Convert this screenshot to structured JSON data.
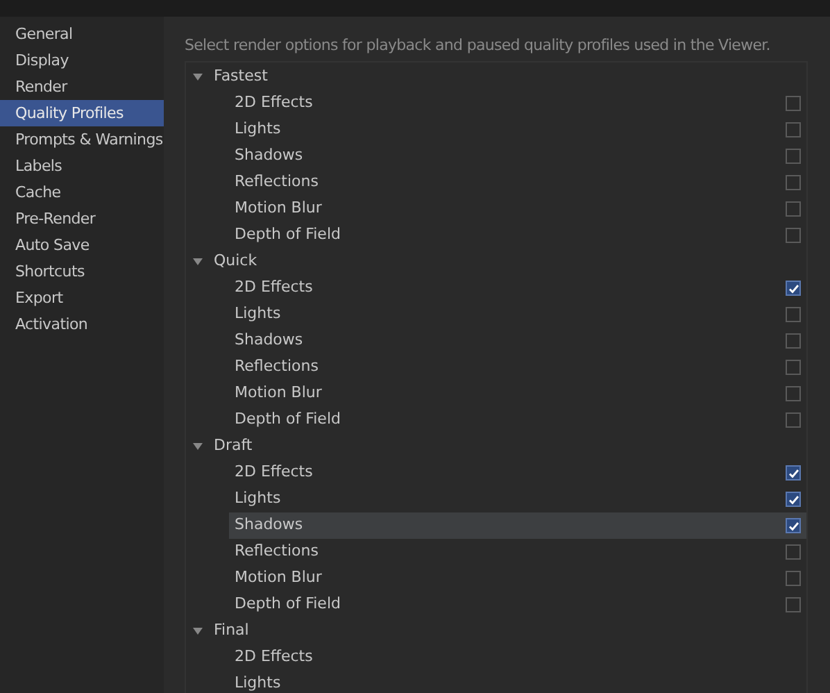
{
  "sidebar": {
    "items": [
      {
        "label": "General",
        "selected": false
      },
      {
        "label": "Display",
        "selected": false
      },
      {
        "label": "Render",
        "selected": false
      },
      {
        "label": "Quality Profiles",
        "selected": true
      },
      {
        "label": "Prompts & Warnings",
        "selected": false
      },
      {
        "label": "Labels",
        "selected": false
      },
      {
        "label": "Cache",
        "selected": false
      },
      {
        "label": "Pre-Render",
        "selected": false
      },
      {
        "label": "Auto Save",
        "selected": false
      },
      {
        "label": "Shortcuts",
        "selected": false
      },
      {
        "label": "Export",
        "selected": false
      },
      {
        "label": "Activation",
        "selected": false
      }
    ]
  },
  "description": "Select render options for playback and paused quality profiles used in the Viewer.",
  "profiles": [
    {
      "label": "Fastest",
      "expanded": true,
      "children": [
        {
          "label": "2D Effects",
          "checked": false,
          "selected": false
        },
        {
          "label": "Lights",
          "checked": false,
          "selected": false
        },
        {
          "label": "Shadows",
          "checked": false,
          "selected": false
        },
        {
          "label": "Reflections",
          "checked": false,
          "selected": false
        },
        {
          "label": "Motion Blur",
          "checked": false,
          "selected": false
        },
        {
          "label": "Depth of Field",
          "checked": false,
          "selected": false
        }
      ]
    },
    {
      "label": "Quick",
      "expanded": true,
      "children": [
        {
          "label": "2D Effects",
          "checked": true,
          "selected": false
        },
        {
          "label": "Lights",
          "checked": false,
          "selected": false
        },
        {
          "label": "Shadows",
          "checked": false,
          "selected": false
        },
        {
          "label": "Reflections",
          "checked": false,
          "selected": false
        },
        {
          "label": "Motion Blur",
          "checked": false,
          "selected": false
        },
        {
          "label": "Depth of Field",
          "checked": false,
          "selected": false
        }
      ]
    },
    {
      "label": "Draft",
      "expanded": true,
      "children": [
        {
          "label": "2D Effects",
          "checked": true,
          "selected": false
        },
        {
          "label": "Lights",
          "checked": true,
          "selected": false
        },
        {
          "label": "Shadows",
          "checked": true,
          "selected": true
        },
        {
          "label": "Reflections",
          "checked": false,
          "selected": false
        },
        {
          "label": "Motion Blur",
          "checked": false,
          "selected": false
        },
        {
          "label": "Depth of Field",
          "checked": false,
          "selected": false
        }
      ]
    },
    {
      "label": "Final",
      "expanded": true,
      "children": [
        {
          "label": "2D Effects",
          "selected": false
        },
        {
          "label": "Lights",
          "selected": false
        }
      ]
    }
  ]
}
